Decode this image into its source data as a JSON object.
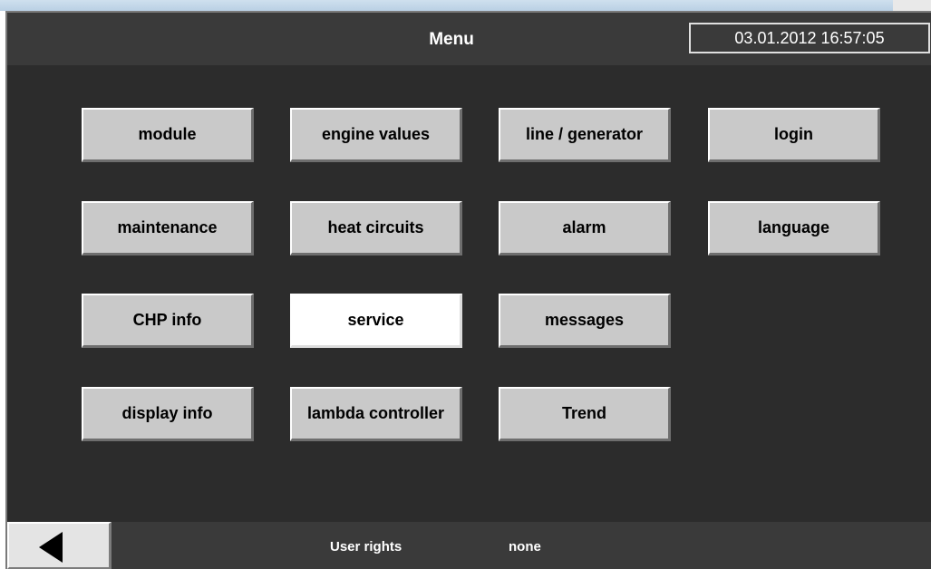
{
  "header": {
    "title": "Menu",
    "datetime": "03.01.2012 16:57:05"
  },
  "menu": {
    "module": "module",
    "engine_values": "engine values",
    "line_generator": "line / generator",
    "login": "login",
    "maintenance": "maintenance",
    "heat_circuits": "heat circuits",
    "alarm": "alarm",
    "language": "language",
    "chp_info": "CHP info",
    "service": "service",
    "messages": "messages",
    "display_info": "display info",
    "lambda_controller": "lambda controller",
    "trend": "Trend"
  },
  "footer": {
    "user_rights_label": "User rights",
    "user_rights_value": "none",
    "back_icon": "left-arrow-icon"
  },
  "colors": {
    "background": "#2c2c2c",
    "bar": "#3a3a3a",
    "button": "#c9c9c9",
    "button_active": "#ffffff"
  }
}
